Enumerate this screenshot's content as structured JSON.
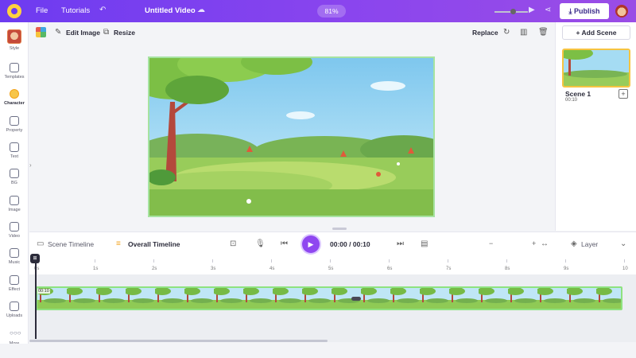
{
  "topbar": {
    "menu_file": "File",
    "menu_tutorials": "Tutorials",
    "undo_icon": "undo-icon",
    "project_title": "Untitled Video",
    "zoom": "81%",
    "publish_label": "Publish"
  },
  "sidebar": {
    "items": [
      {
        "label": "Style",
        "icon": "style-icon"
      },
      {
        "label": "Templates",
        "icon": "templates-icon"
      },
      {
        "label": "Character",
        "icon": "character-icon"
      },
      {
        "label": "Property",
        "icon": "property-icon"
      },
      {
        "label": "Text",
        "icon": "text-icon"
      },
      {
        "label": "BG",
        "icon": "bg-icon"
      },
      {
        "label": "Image",
        "icon": "image-icon"
      },
      {
        "label": "Video",
        "icon": "video-icon"
      },
      {
        "label": "Music",
        "icon": "music-icon"
      },
      {
        "label": "Effect",
        "icon": "effect-icon"
      },
      {
        "label": "Uploads",
        "icon": "uploads-icon"
      },
      {
        "label": "More",
        "icon": "more-icon"
      }
    ],
    "active": "Character"
  },
  "toolbar": {
    "edit_image": "Edit Image",
    "resize": "Resize",
    "replace": "Replace"
  },
  "scenes": {
    "add_label": "+ Add Scene",
    "items": [
      {
        "name": "Scene 1",
        "duration": "00:10"
      }
    ]
  },
  "timeline": {
    "scene_tab": "Scene Timeline",
    "overall_tab": "Overall Timeline",
    "current_time": "00:00",
    "time_separator": "/",
    "total_time": "00:10",
    "layer_label": "Layer",
    "ticks": [
      "0s",
      "1s",
      "2s",
      "3s",
      "4s",
      "5s",
      "6s",
      "7s",
      "8s",
      "9s",
      "10"
    ],
    "track_label": "00:10",
    "zoom_level": 0.55
  },
  "colors": {
    "brand": "#7b3ff2",
    "play_button": "#8f47f0",
    "selection": "#a6e3a1",
    "scene_border": "#f6c440"
  }
}
